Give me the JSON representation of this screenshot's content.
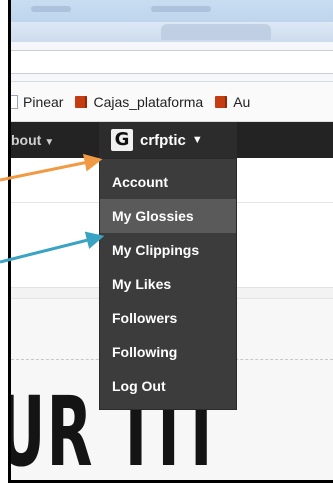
{
  "bookmarks": [
    {
      "label": "Pinear",
      "icon": "page-icon"
    },
    {
      "label": "Cajas_plataforma",
      "icon": "book-icon"
    },
    {
      "label": "Au",
      "icon": "book-icon"
    }
  ],
  "nav": {
    "about_label": "bout",
    "about_caret": "▼",
    "logo_letter": "G",
    "username": "crfptic",
    "user_caret": "▼"
  },
  "menu": {
    "items": [
      {
        "label": "Account",
        "active": false
      },
      {
        "label": "My Glossies",
        "active": true
      },
      {
        "label": "My Clippings",
        "active": false
      },
      {
        "label": "My Likes",
        "active": false
      },
      {
        "label": "Followers",
        "active": false
      },
      {
        "label": "Following",
        "active": false
      },
      {
        "label": "Log Out",
        "active": false
      }
    ]
  },
  "page": {
    "hero_text": "UR TIT"
  },
  "colors": {
    "orange_arrow": "#f29a43",
    "teal_arrow": "#3aa3c3",
    "nav_bg": "#232323",
    "menu_bg": "#3c3c3c",
    "menu_active": "#5a5a5a"
  }
}
